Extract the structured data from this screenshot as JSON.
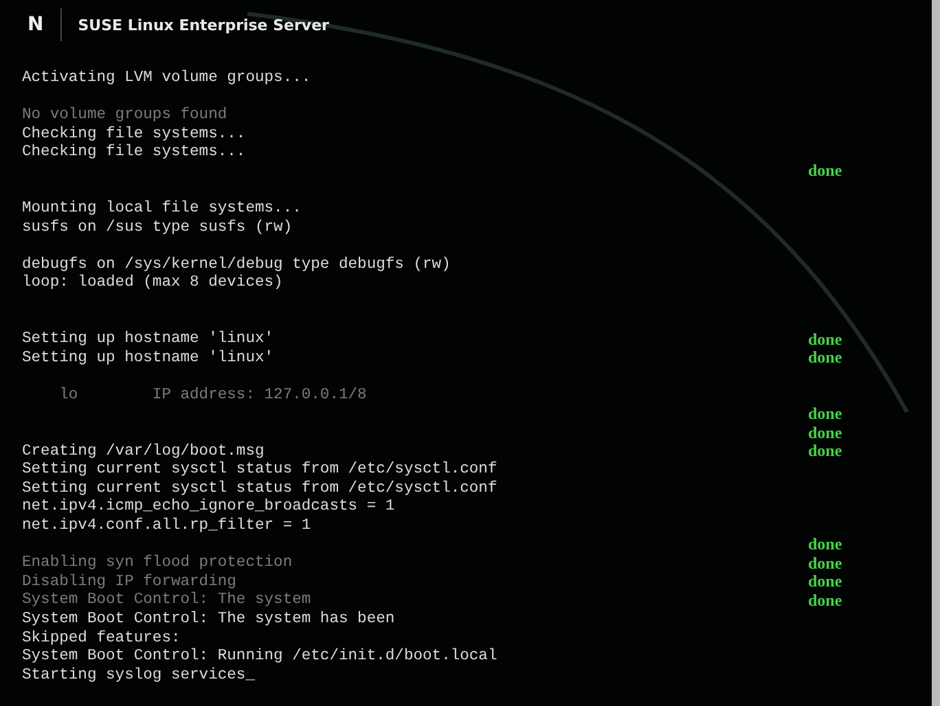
{
  "header": {
    "logo": "N",
    "title": "SUSE Linux Enterprise Server"
  },
  "console_lines": [
    {
      "kind": "line",
      "text": "Activating LVM volume groups..."
    },
    {
      "kind": "blank"
    },
    {
      "kind": "faded",
      "text": "No volume groups found"
    },
    {
      "kind": "line",
      "text": "Checking file systems..."
    },
    {
      "kind": "line",
      "text": "Checking file systems..."
    },
    {
      "kind": "blank",
      "status": "done"
    },
    {
      "kind": "blank"
    },
    {
      "kind": "line",
      "text": "Mounting local file systems..."
    },
    {
      "kind": "line",
      "text": "susfs on /sus type susfs (rw)"
    },
    {
      "kind": "blank"
    },
    {
      "kind": "line",
      "text": "debugfs on /sys/kernel/debug type debugfs (rw)"
    },
    {
      "kind": "line",
      "text": "loop: loaded (max 8 devices)"
    },
    {
      "kind": "blank"
    },
    {
      "kind": "blank"
    },
    {
      "kind": "line",
      "text": "Setting up hostname 'linux'",
      "status": "done"
    },
    {
      "kind": "line",
      "text": "Setting up hostname 'linux'",
      "status": "done"
    },
    {
      "kind": "blank"
    },
    {
      "kind": "faded",
      "text": "    lo        IP address: 127.0.0.1/8"
    },
    {
      "kind": "blank",
      "status": "done"
    },
    {
      "kind": "blank",
      "status": "done"
    },
    {
      "kind": "line",
      "text": "Creating /var/log/boot.msg",
      "status": "done"
    },
    {
      "kind": "line",
      "text": "Setting current sysctl status from /etc/sysctl.conf"
    },
    {
      "kind": "line",
      "text": "Setting current sysctl status from /etc/sysctl.conf"
    },
    {
      "kind": "line",
      "text": "net.ipv4.icmp_echo_ignore_broadcasts = 1"
    },
    {
      "kind": "line",
      "text": "net.ipv4.conf.all.rp_filter = 1"
    },
    {
      "kind": "blank",
      "status": "done"
    },
    {
      "kind": "faded",
      "text": "Enabling syn flood protection",
      "status": "done"
    },
    {
      "kind": "faded",
      "text": "Disabling IP forwarding",
      "status": "done"
    },
    {
      "kind": "faded",
      "text": "System Boot Control: The system",
      "status": "done"
    },
    {
      "kind": "line",
      "text": "System Boot Control: The system has been"
    },
    {
      "kind": "line",
      "text": "Skipped features:"
    },
    {
      "kind": "line",
      "text": "System Boot Control: Running /etc/init.d/boot.local"
    },
    {
      "kind": "line",
      "text": "Starting syslog services_"
    }
  ]
}
